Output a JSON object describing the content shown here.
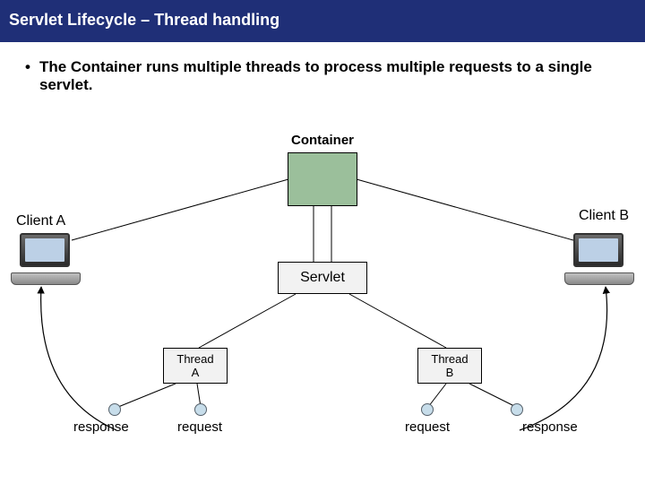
{
  "header": {
    "title": "Servlet Lifecycle – Thread handling"
  },
  "bullet": {
    "marker": "•",
    "text": "The Container runs multiple threads to process multiple requests to a single servlet."
  },
  "diagram": {
    "container_label": "Container",
    "client_a_label": "Client A",
    "client_b_label": "Client B",
    "servlet_label": "Servlet",
    "thread_a": {
      "line1": "Thread",
      "line2": "A"
    },
    "thread_b": {
      "line1": "Thread",
      "line2": "B"
    },
    "labels": {
      "response_a": "response",
      "request_a": "request",
      "request_b": "request",
      "response_b": "response"
    }
  }
}
